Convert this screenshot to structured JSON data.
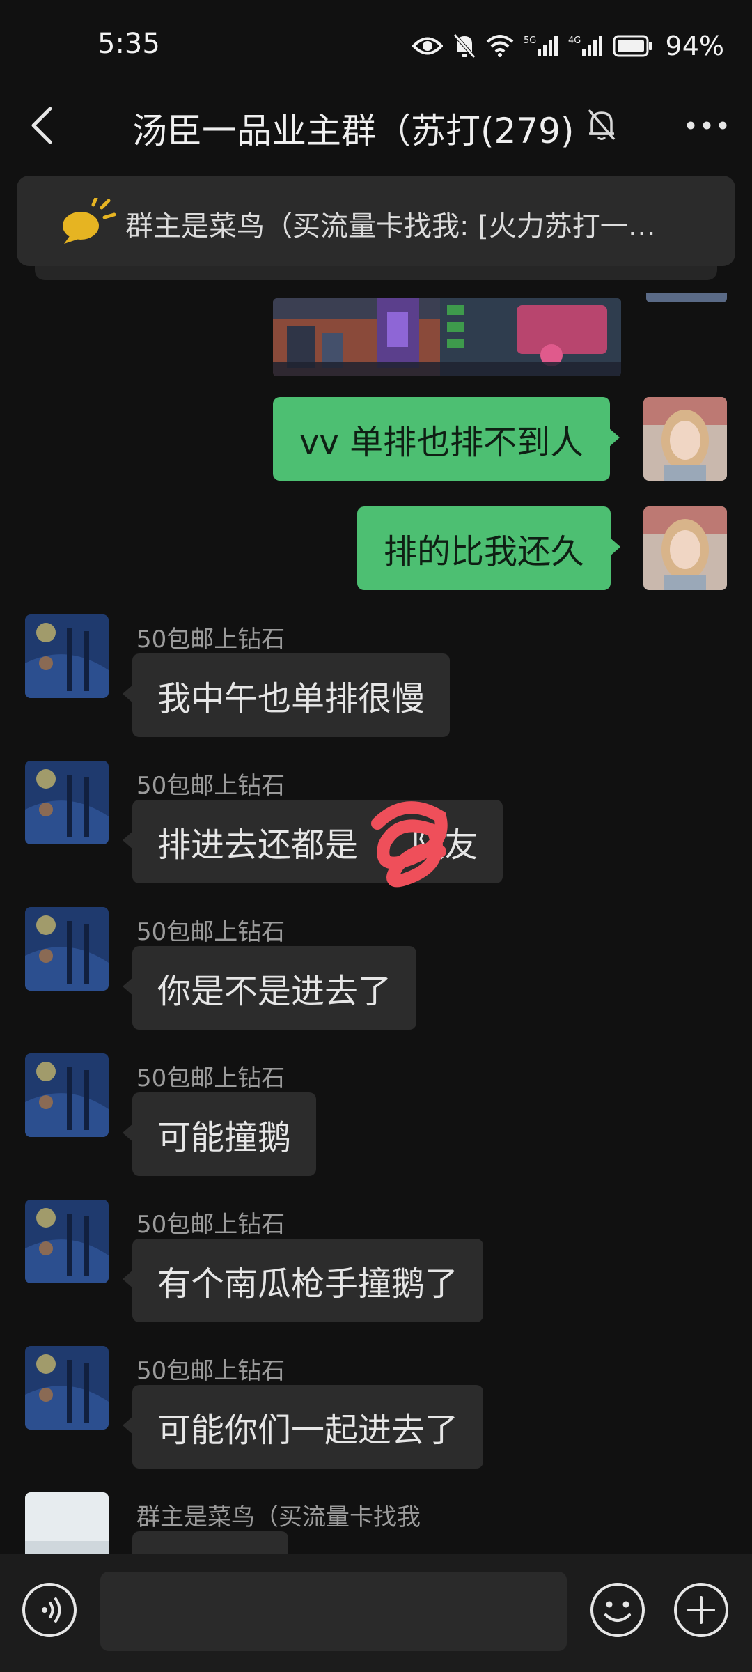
{
  "status_bar": {
    "time": "5:35",
    "network_1": "5G",
    "network_2": "4G",
    "battery": "94%",
    "icons": [
      "eye-icon",
      "bell-off-icon",
      "wifi-icon",
      "signal-5g-icon",
      "signal-4g-icon",
      "battery-icon"
    ]
  },
  "header": {
    "title": "汤臣一品业主群（苏打(279)",
    "icons": [
      "back-arrow-icon",
      "mute-bell-icon",
      "more-dots-icon"
    ]
  },
  "announcement": {
    "text": "群主是菜鸟（买流量卡找我: [火力苏打一…",
    "icon": "megaphone-icon"
  },
  "messages": [
    {
      "side": "out",
      "text": "vv 单排也排不到人"
    },
    {
      "side": "out",
      "text": "排的比我还久"
    },
    {
      "side": "in",
      "sender": "50包邮上钻石",
      "text": "我中午也单排很慢"
    },
    {
      "side": "in",
      "sender": "50包邮上钻石",
      "text": "排进去还都是     队友"
    },
    {
      "side": "in",
      "sender": "50包邮上钻石",
      "text": "你是不是进去了"
    },
    {
      "side": "in",
      "sender": "50包邮上钻石",
      "text": "可能撞鹅"
    },
    {
      "side": "in",
      "sender": "50包邮上钻石",
      "text": "有个南瓜枪手撞鹅了"
    },
    {
      "side": "in",
      "sender": "50包邮上钻石",
      "text": "可能你们一起进去了"
    },
    {
      "side": "in",
      "sender": "群主是菜鸟（买流量卡找我",
      "text": ""
    }
  ],
  "input_bar": {
    "placeholder": "",
    "icons": [
      "voice-icon",
      "emoji-icon",
      "plus-icon"
    ]
  },
  "colors": {
    "background": "#111111",
    "outgoing_bubble": "#4dbf72",
    "incoming_bubble": "#2c2c2c",
    "sender_name": "#9b9b9b"
  }
}
